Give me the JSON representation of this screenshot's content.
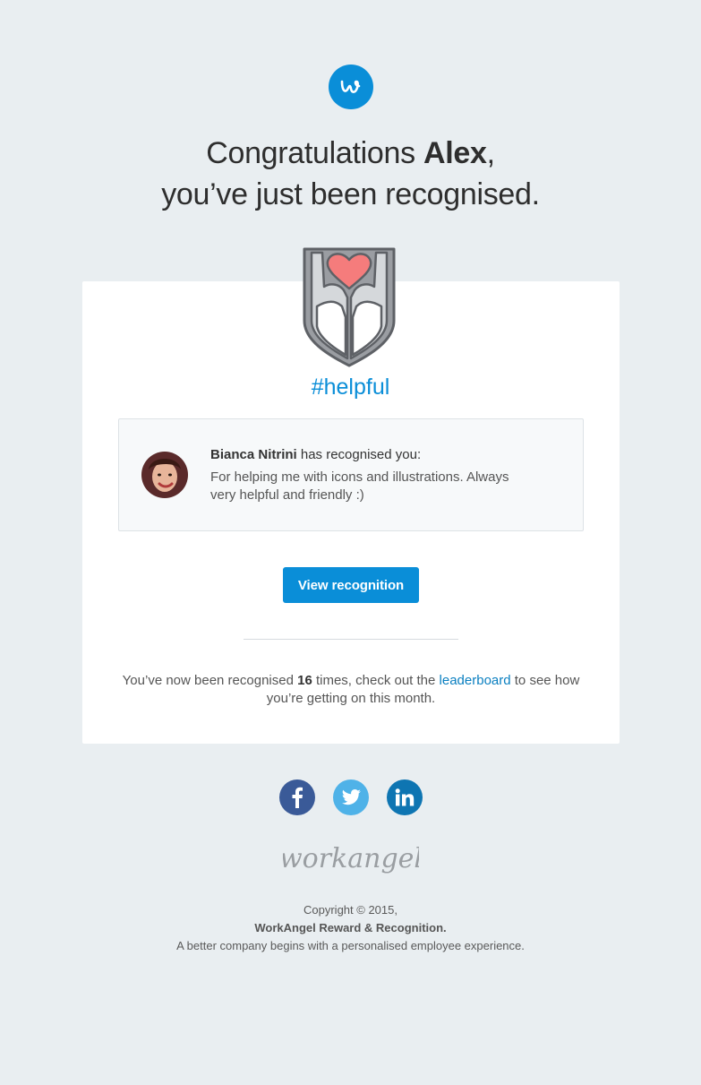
{
  "header": {
    "logo_icon": "workangel-w-icon",
    "greeting_prefix": "Congratulations",
    "name": "Alex",
    "greeting_suffix": ",",
    "line2": "you’ve just been recognised."
  },
  "badge": {
    "icon": "hands-holding-heart-icon",
    "tag": "#helpful"
  },
  "message": {
    "sender": "Bianca Nitrini",
    "action": " has recognised you:",
    "body": "For helping me with icons and illustrations. Always very helpful and friendly :)"
  },
  "cta": {
    "label": "View recognition"
  },
  "summary": {
    "prefix": "You’ve now been recognised ",
    "count": "16",
    "middle": " times, check out the ",
    "link": "leaderboard",
    "suffix": " to see how you’re getting on this month."
  },
  "social": [
    {
      "icon": "facebook-icon",
      "glyph": "f"
    },
    {
      "icon": "twitter-icon",
      "glyph": ""
    },
    {
      "icon": "linkedin-icon",
      "glyph": "in"
    }
  ],
  "footer": {
    "wordmark": "workangel",
    "copyright": "Copyright © 2015,",
    "company": "WorkAngel Reward & Recognition.",
    "tagline": "A better company begins with a personalised employee experience."
  },
  "colors": {
    "background": "#e9eef1",
    "accent": "#0a8ed8",
    "heart": "#f57c7c",
    "facebook": "#3a5a98",
    "twitter": "#4fb2e8",
    "linkedin": "#0e75b2"
  }
}
